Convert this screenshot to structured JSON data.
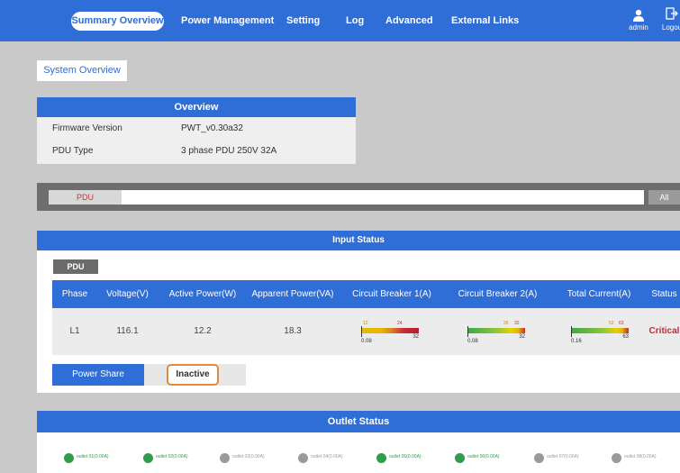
{
  "nav": {
    "active": "Summary Overview",
    "items": [
      "Power Management",
      "Setting",
      "Log",
      "Advanced",
      "External Links"
    ],
    "user_label": "admin",
    "logout_label": "Logou"
  },
  "subtab": "System Overview",
  "overview": {
    "title": "Overview",
    "rows": [
      {
        "key": "Firmware Version",
        "value": "PWT_v0.30a32"
      },
      {
        "key": "PDU Type",
        "value": "3 phase PDU 250V 32A"
      }
    ]
  },
  "pdu_bar": {
    "tab": "PDU",
    "end": "All"
  },
  "input_status": {
    "title": "Input Status",
    "pdu_tag": "PDU",
    "headers": [
      "Phase",
      "Voltage(V)",
      "Active Power(W)",
      "Apparent Power(VA)",
      "Circuit Breaker 1(A)",
      "Circuit Breaker 2(A)",
      "Total Current(A)",
      "Status"
    ],
    "row": {
      "phase": "L1",
      "voltage": "116.1",
      "active_power": "12.2",
      "apparent_power": "18.3",
      "breaker1": {
        "min_label": "0.08",
        "lo": "0",
        "hi": "32",
        "mark_a": "12",
        "mark_b": "24"
      },
      "breaker2": {
        "min_label": "0.08",
        "lo": "0",
        "hi": "32",
        "mark_a": "26",
        "mark_b": "32"
      },
      "total": {
        "min_label": "0.16",
        "lo": "0",
        "hi": "63",
        "mark_a": "52",
        "mark_b": "63"
      },
      "status": "Critical"
    },
    "power_share_label": "Power Share",
    "power_share_state": "Inactive"
  },
  "outlet_status": {
    "title": "Outlet Status",
    "outlets": [
      {
        "name": "outlet 01(0.00A)",
        "state": "on"
      },
      {
        "name": "outlet 02(0.00A)",
        "state": "on"
      },
      {
        "name": "outlet 03(0.00A)",
        "state": "off"
      },
      {
        "name": "outlet 04(0.00A)",
        "state": "off"
      },
      {
        "name": "outlet 05(0.00A)",
        "state": "on"
      },
      {
        "name": "outlet 06(0.00A)",
        "state": "on"
      },
      {
        "name": "outlet 07(0.00A)",
        "state": "off"
      },
      {
        "name": "outlet 08(0.00A)",
        "state": "off"
      }
    ]
  },
  "colors": {
    "accent": "#2f6ed6",
    "critical": "#c8283a",
    "outlet_on": "#2f9e4a",
    "outlet_off": "#9a9a9a"
  }
}
